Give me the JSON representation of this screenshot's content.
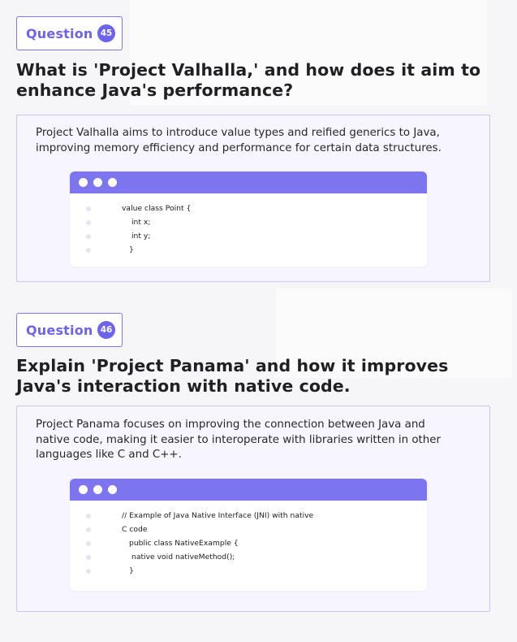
{
  "questions": [
    {
      "label": "Question",
      "number": "45",
      "title_line1": "What is 'Project Valhalla,' and how does it aim to",
      "title_line2": "enhance Java's performance?",
      "answer_line1": "Project Valhalla aims to introduce value types and reified generics to Java,",
      "answer_line2": "improving memory efficiency and performance for certain data structures.",
      "answer_line3": "",
      "code": [
        "value class Point {",
        "int x;",
        "int y;",
        "}"
      ]
    },
    {
      "label": "Question",
      "number": "46",
      "title_line1": "Explain 'Project Panama' and how it improves",
      "title_line2": "Java's interaction with native code.",
      "answer_line1": "Project Panama focuses on improving the connection between Java and",
      "answer_line2": "native code, making it easier to interoperate with libraries written in other",
      "answer_line3": "languages like C and C++.",
      "code": [
        "// Example of Java Native Interface (JNI) with native",
        "C code",
        "public class NativeExample {",
        "native void nativeMethod();",
        "}"
      ]
    }
  ],
  "colors": {
    "accent": "#6c63ee",
    "code_bar": "#7d75f0",
    "card_border": "#c9c6f3",
    "card_bg": "#f7f6fe"
  }
}
